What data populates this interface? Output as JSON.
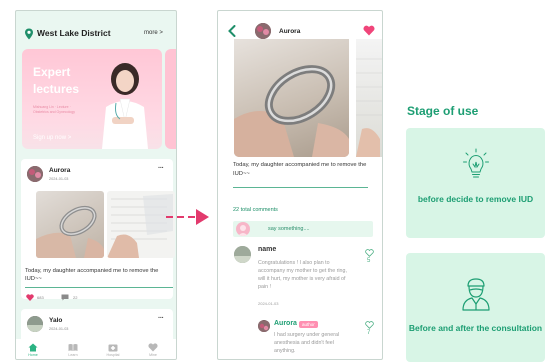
{
  "left_phone": {
    "location": "West Lake District",
    "more": "more >",
    "banner": {
      "title": "Expert lectures",
      "details": "Mishuang Lin · Lecture · Obstetrics and Gynecology",
      "cta": "Sign up now >"
    },
    "posts": [
      {
        "user": "Aurora",
        "date": "2024-01-03",
        "text": "Today, my daughter accompanied me to remove the IUD~~",
        "likes": "683",
        "comments": "22"
      },
      {
        "user": "Yalo",
        "date": "2024-01-03"
      }
    ],
    "tabs": [
      {
        "label": "Home",
        "icon": "home-icon",
        "active": true
      },
      {
        "label": "Learn",
        "icon": "book-icon",
        "active": false
      },
      {
        "label": "Hospital",
        "icon": "hospital-icon",
        "active": false
      },
      {
        "label": "Mine",
        "icon": "heart-icon",
        "active": false
      }
    ]
  },
  "right_phone": {
    "header_user": "Aurora",
    "post_text": "Today, my daughter accompanied me to remove the IUD~~",
    "total_comments": "22 total comments",
    "comment_placeholder": "say something....",
    "comments": [
      {
        "name": "name",
        "text": "Congratulations ! I also plan to accompany my mother to get the ring, will it hurt, my mother is very afraid of pain !",
        "date": "2024-01-03",
        "likes": "5"
      },
      {
        "name": "Aurora",
        "badge": "author",
        "text": "I had surgery under general anesthesia and didn't feel anything.",
        "likes": "7"
      }
    ]
  },
  "stage": {
    "title": "Stage of use",
    "cards": [
      {
        "label": "before  decide to remove  IUD",
        "icon": "lightbulb-icon"
      },
      {
        "label": "Before and after the consultation",
        "icon": "nurse-icon"
      }
    ]
  },
  "colors": {
    "accent": "#1d9e73",
    "pink": "#e23a6d",
    "card_bg": "#d8f5e6",
    "phone_bg": "#eaf7f1"
  }
}
